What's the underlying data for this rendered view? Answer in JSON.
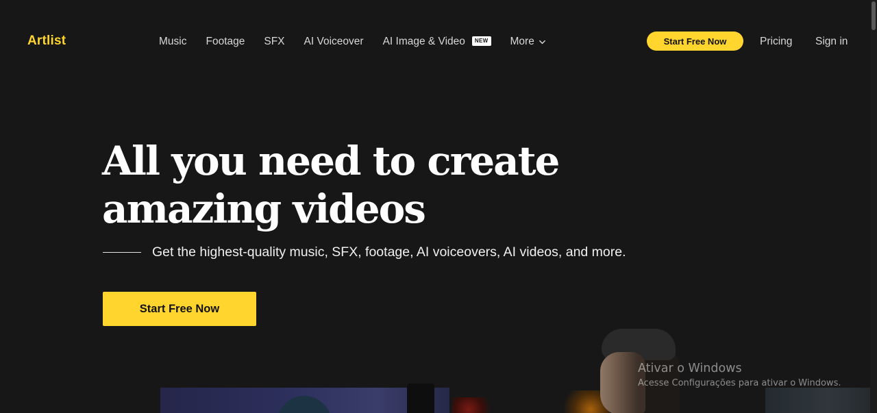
{
  "header": {
    "logo": "Artlist",
    "nav": {
      "music": "Music",
      "footage": "Footage",
      "sfx": "SFX",
      "ai_voiceover": "AI Voiceover",
      "ai_image_video": "AI Image & Video",
      "new_badge": "NEW",
      "more": "More"
    },
    "cta": "Start Free Now",
    "pricing": "Pricing",
    "sign_in": "Sign in"
  },
  "hero": {
    "title_line1": "All you need to create",
    "title_line2": "amazing videos",
    "subtitle": "Get the highest-quality music, SFX, footage, AI voiceovers, AI videos, and more.",
    "cta": "Start Free Now"
  },
  "watermark": {
    "title": "Ativar o Windows",
    "subtitle": "Acesse Configurações para ativar o Windows."
  },
  "colors": {
    "background": "#171717",
    "accent": "#ffd52e",
    "text": "#ffffff",
    "nav_text": "#d8d8d8"
  },
  "icons": {
    "more_dropdown": "chevron-down-icon"
  }
}
